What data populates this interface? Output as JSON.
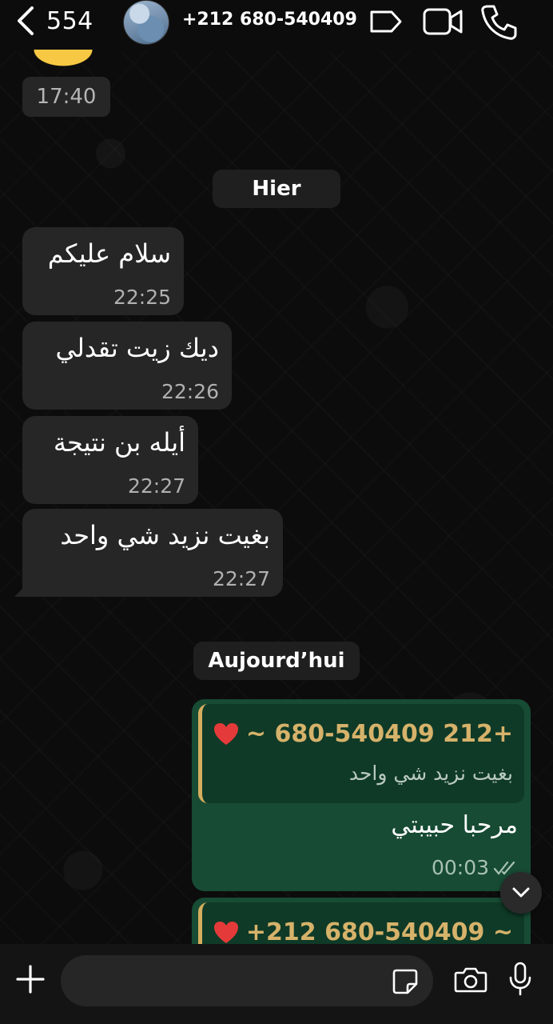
{
  "header": {
    "back_count": "554",
    "contact_name": "+212 680-540409",
    "icons": [
      "chevron-left-icon",
      "tag-icon",
      "video-icon",
      "phone-icon"
    ]
  },
  "messages": {
    "earlier_time": "17:40",
    "day1_label": "Hier",
    "incoming": [
      {
        "text": "سلام عليكم",
        "time": "22:25"
      },
      {
        "text": "ديك زيت تقدلي",
        "time": "22:26"
      },
      {
        "text": "أيله بن نتيجة",
        "time": "22:27"
      },
      {
        "text": "بغيت نزيد شي واحد",
        "time": "22:27"
      }
    ],
    "day2_label": "Aujourd’hui",
    "outgoing": [
      {
        "quote_name": "+212 680-540409 ~",
        "quote_text": "بغيت نزيد شي واحد",
        "text": "مرحبا حبيبتي",
        "time": "00:03"
      },
      {
        "quote_name": "+212 680-540409 ~"
      }
    ]
  },
  "composer": {
    "placeholder": "",
    "icons": [
      "plus-icon",
      "sticker-icon",
      "camera-icon",
      "mic-icon"
    ]
  },
  "colors": {
    "incoming_bubble": "#262626",
    "outgoing_bubble": "#174b34",
    "quote_accent": "#d4ae5e",
    "quote_name": "#d6b26a"
  }
}
